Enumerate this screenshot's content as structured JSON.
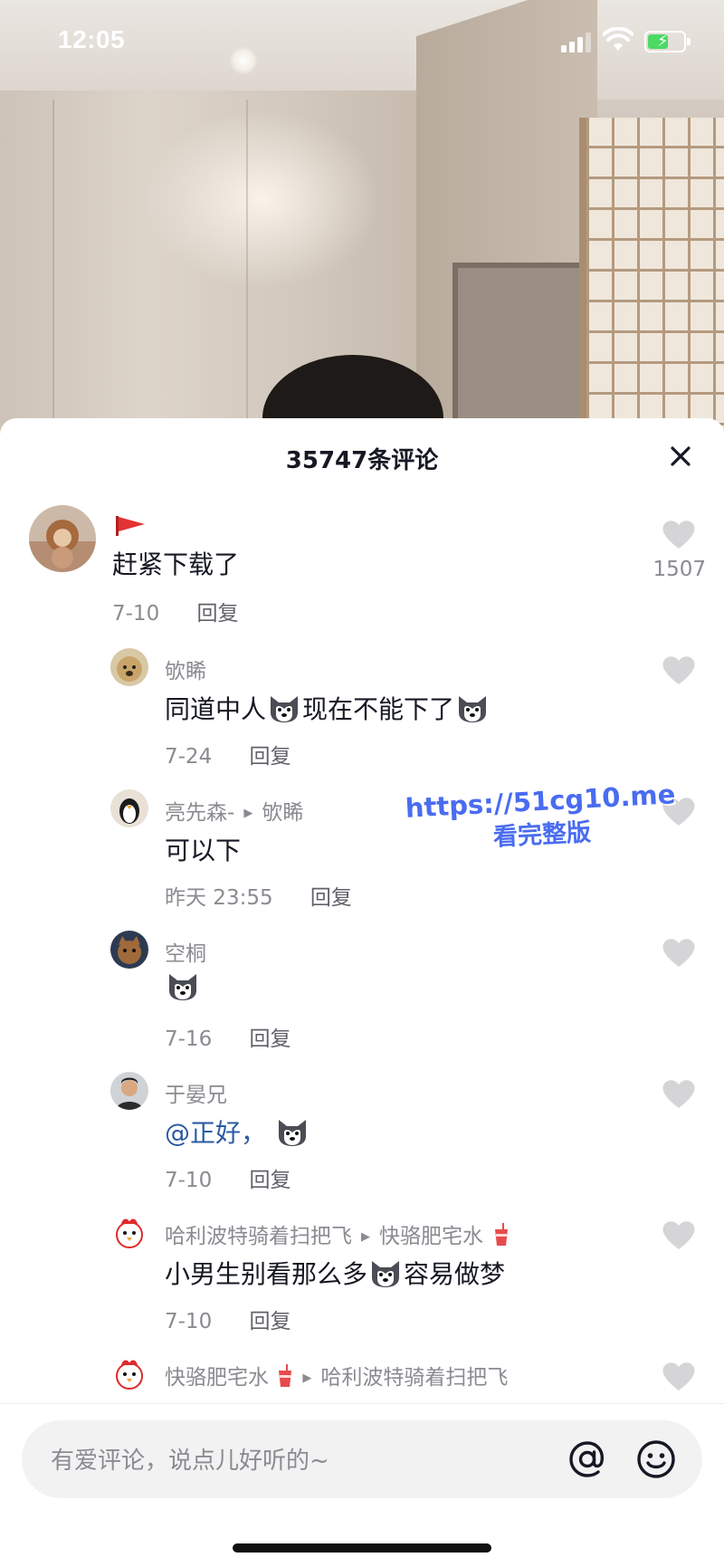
{
  "status_bar": {
    "time": "12:05",
    "icons": [
      "signal-icon",
      "wifi-icon",
      "battery-charging-icon"
    ],
    "battery_color": "#4cd964"
  },
  "sheet": {
    "title": "35747条评论",
    "close_icon": "close-icon"
  },
  "comments": [
    {
      "avatar": "lion-avatar",
      "badge_icon": "red-flag-icon",
      "text": "赶紧下载了",
      "date": "7-10",
      "reply_label": "回复",
      "likes": "1507"
    },
    {
      "username": "欨睎",
      "text_parts": [
        "同道中人",
        "现在不能下了"
      ],
      "emoji": "husky-emoji",
      "date": "7-24",
      "reply_label": "回复"
    },
    {
      "username": "亮先森-",
      "reply_to": "欨睎",
      "text": "可以下",
      "date": "昨天 23:55",
      "reply_label": "回复"
    },
    {
      "username": "空桐",
      "emoji": "husky-emoji",
      "date": "7-16",
      "reply_label": "回复"
    },
    {
      "username": "于晏兄",
      "mention": "@正好，",
      "emoji": "husky-emoji",
      "date": "7-10",
      "reply_label": "回复"
    },
    {
      "username": "哈利波特骑着扫把飞",
      "reply_to": "快骆肥宅水",
      "reply_to_emoji": "soda-cup-emoji",
      "text_parts": [
        "小男生别看那么多",
        "容易做梦"
      ],
      "emoji": "husky-emoji",
      "date": "7-10",
      "reply_label": "回复"
    },
    {
      "username": "快骆肥宅水",
      "username_emoji": "soda-cup-emoji",
      "reply_to": "哈利波特骑着扫把飞"
    }
  ],
  "watermark": {
    "url": "https://51cg10.me",
    "subtitle": "看完整版",
    "color": "#4a6cf0"
  },
  "input_bar": {
    "placeholder": "有爱评论，说点儿好听的~",
    "at_icon": "at-icon",
    "emoji_icon": "smiley-icon"
  }
}
